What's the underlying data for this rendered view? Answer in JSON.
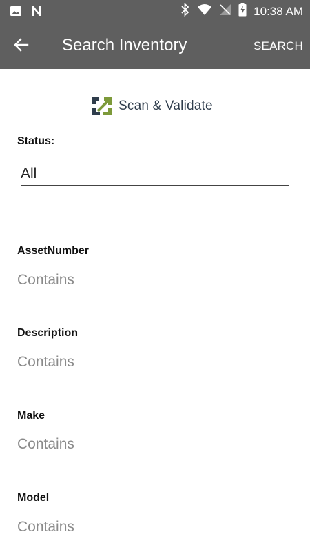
{
  "status_bar": {
    "time": "10:38 AM",
    "icons": [
      "image-icon",
      "n-icon",
      "bluetooth-icon",
      "wifi-icon",
      "no-sim-icon",
      "battery-charging-icon"
    ]
  },
  "app_bar": {
    "title": "Search Inventory",
    "action_label": "SEARCH"
  },
  "logo": {
    "text": "Scan & Validate"
  },
  "status_filter": {
    "label": "Status:",
    "value": "All"
  },
  "fields": [
    {
      "label": "AssetNumber",
      "placeholder": "Contains"
    },
    {
      "label": "Description",
      "placeholder": "Contains"
    },
    {
      "label": "Make",
      "placeholder": "Contains"
    },
    {
      "label": "Model",
      "placeholder": "Contains"
    }
  ],
  "colors": {
    "app_bar": "#5f5f5f",
    "logo_green": "#7d9a3a",
    "logo_navy": "#2f3d4c",
    "placeholder": "#8a8a8a"
  }
}
